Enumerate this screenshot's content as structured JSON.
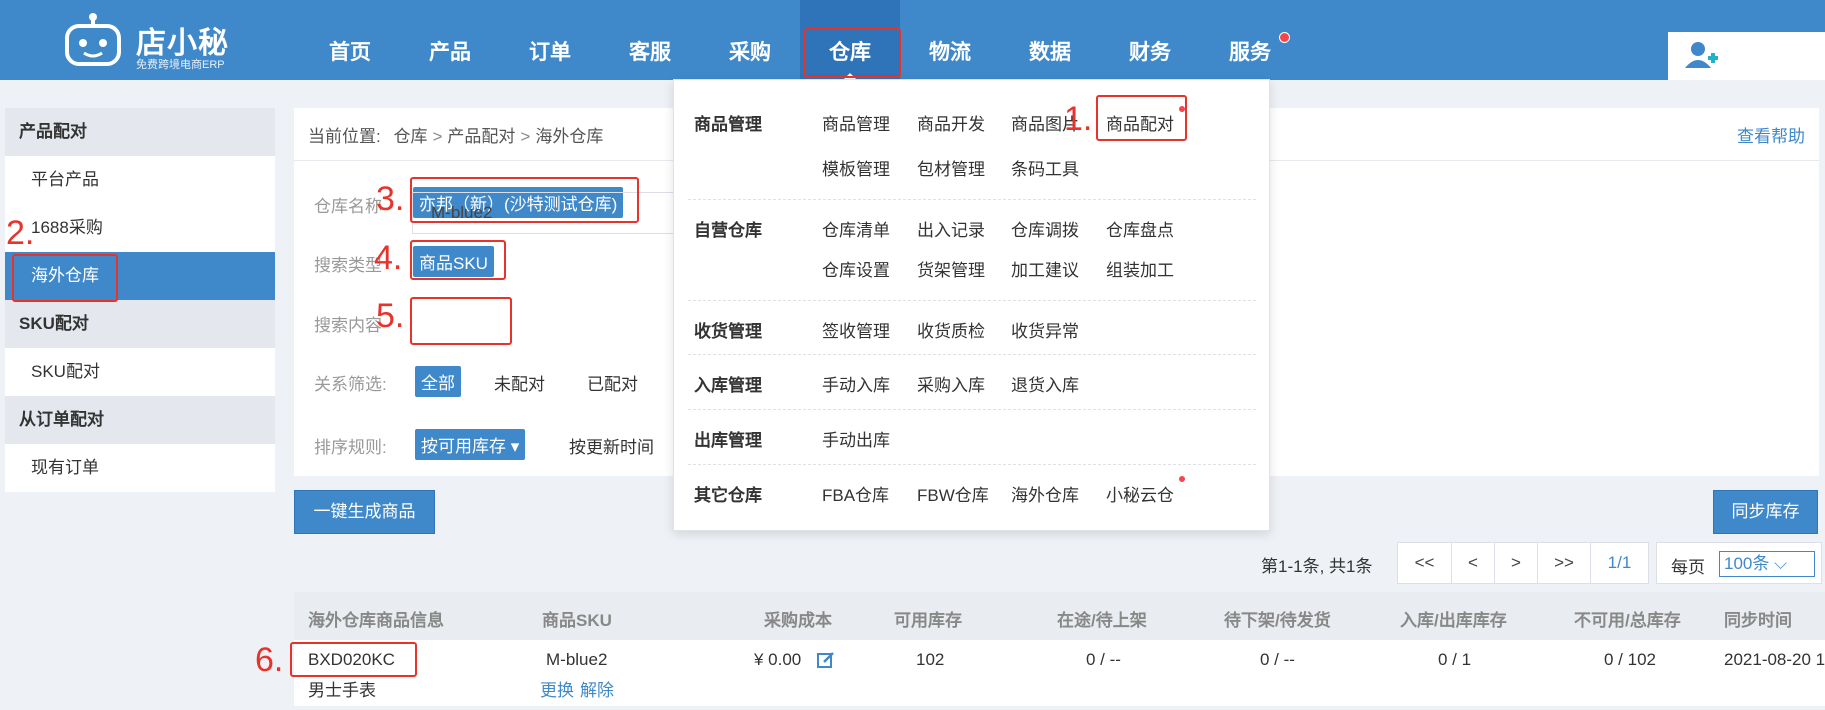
{
  "brand": {
    "name": "店小秘",
    "tagline": "免费跨境电商ERP"
  },
  "nav": {
    "items": [
      "首页",
      "产品",
      "订单",
      "客服",
      "采购",
      "仓库",
      "物流",
      "数据",
      "财务",
      "服务"
    ],
    "active": "仓库"
  },
  "sidebar": {
    "sections": [
      {
        "title": "产品配对",
        "items": [
          "平台产品",
          "1688采购",
          "海外仓库"
        ]
      },
      {
        "title": "SKU配对",
        "items": [
          "SKU配对"
        ]
      },
      {
        "title": "从订单配对",
        "items": [
          "现有订单"
        ]
      }
    ],
    "active_item": "海外仓库"
  },
  "breadcrumb": {
    "prefix": "当前位置:",
    "parts": [
      "仓库",
      "产品配对",
      "海外仓库"
    ],
    "sep": ">"
  },
  "help_label": "查看帮助",
  "filters": {
    "warehouse_label": "仓库名称",
    "warehouse_value": "亦邦（新）(沙特测试仓库)",
    "search_type_label": "搜索类型",
    "search_type_value": "商品SKU",
    "search_content_label": "搜索内容",
    "search_content_value": "M-blue2",
    "relation_label": "关系筛选:",
    "relation_options": [
      "全部",
      "未配对",
      "已配对"
    ],
    "relation_selected": "全部",
    "sort_label": "排序规则:",
    "sort_selected": "按可用库存 ▾",
    "sort_other": "按更新时间"
  },
  "buttons": {
    "generate": "一键生成商品",
    "sync": "同步库存"
  },
  "pagination": {
    "info": "第1-1条, 共1条",
    "first": "<<",
    "prev": "<",
    "next": ">",
    "last": ">>",
    "current": "1/1",
    "per_page_label": "每页",
    "per_page_value": "100条 ⌵"
  },
  "table": {
    "headers": [
      "海外仓库商品信息",
      "商品SKU",
      "采购成本",
      "可用库存",
      "在途/待上架",
      "待下架/待发货",
      "入库/出库库存",
      "不可用/总库存",
      "同步时间"
    ],
    "rows": [
      {
        "code": "BXD020KC",
        "name": "男士手表",
        "sku": "M-blue2",
        "sku_actions": [
          "更换",
          "解除"
        ],
        "cost": "¥ 0.00",
        "available": "102",
        "in_transit": "0 / --",
        "pending": "0 / --",
        "in_out": "0 / 1",
        "unavailable_total": "0 / 102",
        "sync_time": "2021-08-20 1"
      }
    ]
  },
  "menu": {
    "groups": [
      {
        "title": "商品管理",
        "links": [
          "商品管理",
          "商品开发",
          "商品图片",
          "商品配对",
          "模板管理",
          "包材管理",
          "条码工具"
        ]
      },
      {
        "title": "自营仓库",
        "links": [
          "仓库清单",
          "出入记录",
          "仓库调拨",
          "仓库盘点",
          "仓库设置",
          "货架管理",
          "加工建议",
          "组装加工"
        ]
      },
      {
        "title": "收货管理",
        "links": [
          "签收管理",
          "收货质检",
          "收货异常"
        ]
      },
      {
        "title": "入库管理",
        "links": [
          "手动入库",
          "采购入库",
          "退货入库"
        ]
      },
      {
        "title": "出库管理",
        "links": [
          "手动出库"
        ]
      },
      {
        "title": "其它仓库",
        "links": [
          "FBA仓库",
          "FBW仓库",
          "海外仓库",
          "小秘云仓"
        ]
      }
    ]
  },
  "annotations": [
    "1.",
    "2.",
    "3.",
    "4.",
    "5.",
    "6."
  ],
  "colors": {
    "primary": "#3f89ca",
    "annotation": "#e8332b",
    "dot": "#f5474b"
  }
}
